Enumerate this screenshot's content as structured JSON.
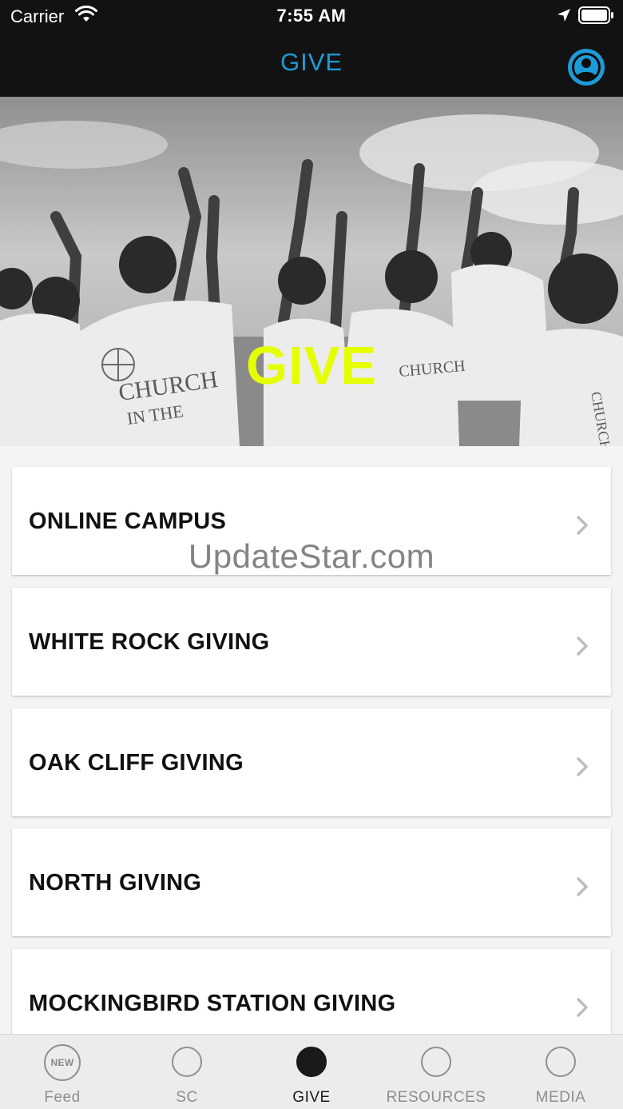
{
  "status_bar": {
    "carrier": "Carrier",
    "time": "7:55 AM"
  },
  "nav": {
    "title": "GIVE",
    "title_color": "#1d9bd8"
  },
  "hero": {
    "title": "GIVE",
    "title_color": "#e5ff00",
    "image": "grayscale-crowd-raising-hands-photo",
    "shirt_text": "CHURCH IN THE WORLD"
  },
  "giving_options": [
    {
      "label": "ONLINE CAMPUS"
    },
    {
      "label": "WHITE ROCK GIVING"
    },
    {
      "label": "OAK CLIFF GIVING"
    },
    {
      "label": "NORTH GIVING"
    },
    {
      "label": "MOCKINGBIRD STATION GIVING"
    }
  ],
  "watermark": "UpdateStar.com",
  "tabs": [
    {
      "label": "Feed",
      "badge": "NEW",
      "icon": "new-badge-icon",
      "active": false
    },
    {
      "label": "SC",
      "icon": "circle-icon",
      "active": false
    },
    {
      "label": "GIVE",
      "icon": "filled-circle-icon",
      "active": true
    },
    {
      "label": "RESOURCES",
      "icon": "circle-icon",
      "active": false
    },
    {
      "label": "MEDIA",
      "icon": "circle-icon",
      "active": false
    }
  ],
  "colors": {
    "nav_background": "#121212",
    "accent": "#1d9bd8",
    "list_background": "#f4f4f4",
    "tab_active": "#1a1a1a",
    "tab_inactive": "#8e8e8e"
  }
}
